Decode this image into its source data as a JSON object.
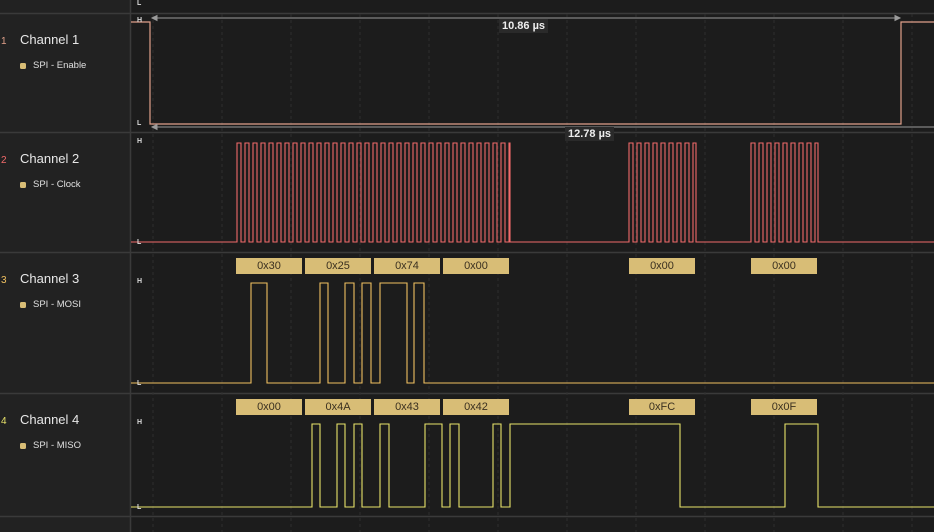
{
  "colors": {
    "background": "#1c1c1c",
    "panel": "#222222",
    "separator": "#3a3a3a",
    "badge": "#d8bd76",
    "channel1": "#e0a08a",
    "channel2": "#f06a6a",
    "channel3": "#f0c060",
    "channel4": "#e9e36a"
  },
  "top_marker": "L",
  "channels": [
    {
      "number": "1",
      "name": "Channel 1",
      "protocol": "SPI - Enable",
      "high": "H",
      "low": "L",
      "number_color": "#e0a08a",
      "dot_color": "#d8bd76"
    },
    {
      "number": "2",
      "name": "Channel 2",
      "protocol": "SPI - Clock",
      "high": "H",
      "low": "L",
      "number_color": "#f06a6a",
      "dot_color": "#d8bd76"
    },
    {
      "number": "3",
      "name": "Channel 3",
      "protocol": "SPI - MOSI",
      "high": "H",
      "low": "L",
      "number_color": "#f0c060",
      "dot_color": "#d8bd76"
    },
    {
      "number": "4",
      "name": "Channel 4",
      "protocol": "SPI - MISO",
      "high": "H",
      "low": "L",
      "number_color": "#e9e36a",
      "dot_color": "#d8bd76"
    }
  ],
  "measurements": {
    "enable_high": "10.86 µs",
    "enable_span": "12.78 µs"
  },
  "mosi_bytes": [
    "0x30",
    "0x25",
    "0x74",
    "0x00",
    "0x00",
    "0x00"
  ],
  "miso_bytes": [
    "0x00",
    "0x4A",
    "0x43",
    "0x42",
    "0xFC",
    "0x0F"
  ]
}
